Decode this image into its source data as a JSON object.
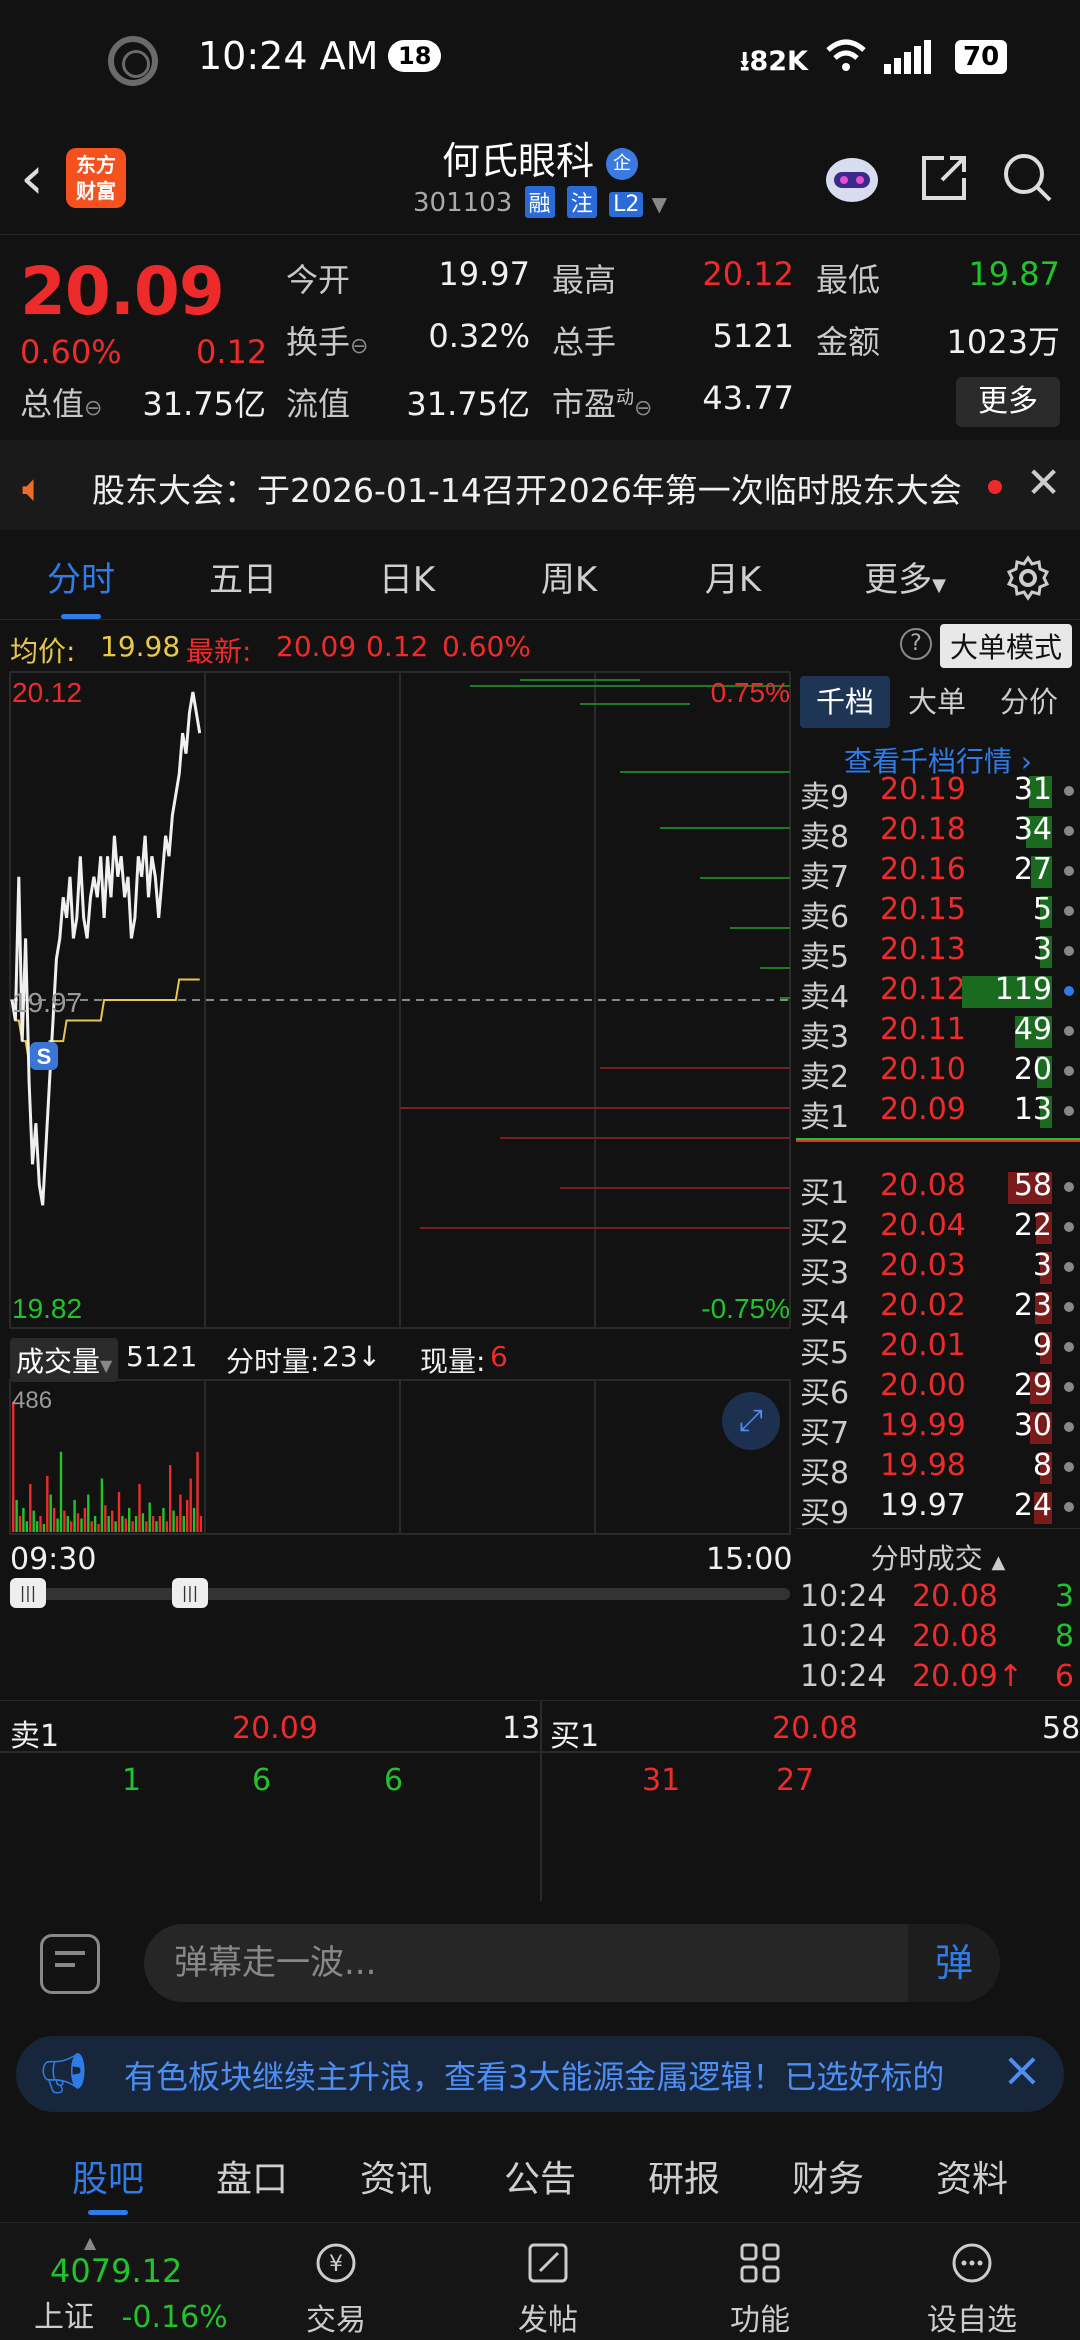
{
  "status": {
    "time": "10:24 AM",
    "badge": "18",
    "net": "82K",
    "battery": "70"
  },
  "header": {
    "logo_text_1": "东方",
    "logo_text_2": "财富",
    "name": "何氏眼科",
    "name_tag": "企",
    "code": "301103",
    "tags": [
      "融",
      "注",
      "L2"
    ]
  },
  "quote": {
    "price": "20.09",
    "change_pct": "0.60%",
    "change": "0.12",
    "rows": [
      [
        {
          "label": "今开",
          "value": "19.97",
          "color": "white"
        },
        {
          "label": "最高",
          "value": "20.12",
          "color": "red"
        },
        {
          "label": "最低",
          "value": "19.87",
          "color": "green"
        }
      ],
      [
        {
          "label": "换手",
          "value": "0.32%",
          "color": "white"
        },
        {
          "label": "总手",
          "value": "5121",
          "color": "white"
        },
        {
          "label": "金额",
          "value": "1023万",
          "color": "white"
        }
      ],
      [
        {
          "label": "总值",
          "value": "31.75亿",
          "color": "white"
        },
        {
          "label": "流值",
          "value": "31.75亿",
          "color": "white"
        },
        {
          "label": "市盈",
          "value": "43.77",
          "color": "white"
        }
      ]
    ],
    "pe_superscript": "动",
    "more_label": "更多"
  },
  "notice": {
    "text": "股东大会：于2026-01-14召开2026年第一次临时股东大会"
  },
  "chart_tabs": [
    "分时",
    "五日",
    "日K",
    "周K",
    "月K",
    "更多"
  ],
  "avg": {
    "avg_label": "均价:",
    "avg_value": "19.98",
    "latest_label": "最新:",
    "latest_value": "20.09",
    "change": "0.12",
    "pct": "0.60%",
    "mode_label": "大单模式",
    "help": "?"
  },
  "chart": {
    "top_price": "20.12",
    "top_pct": "0.75%",
    "mid_price": "19.97",
    "bottom_price": "19.82",
    "bottom_pct": "-0.75%",
    "s_marker": "S"
  },
  "volume": {
    "label": "成交量",
    "total": "5121",
    "minute_label": "分时量:",
    "minute_value": "23↓",
    "now_label": "现量:",
    "now_value": "6",
    "max": "486",
    "time_start": "09:30",
    "time_end": "15:00"
  },
  "orderbook": {
    "tabs": [
      "千档",
      "大单",
      "分价"
    ],
    "link": "查看千档行情 ›",
    "asks": [
      {
        "label": "卖9",
        "price": "20.19",
        "qty": "31",
        "w": 0.26
      },
      {
        "label": "卖8",
        "price": "20.18",
        "qty": "34",
        "w": 0.29
      },
      {
        "label": "卖7",
        "price": "20.16",
        "qty": "27",
        "w": 0.23
      },
      {
        "label": "卖6",
        "price": "20.15",
        "qty": "5",
        "w": 0.04
      },
      {
        "label": "卖5",
        "price": "20.13",
        "qty": "3",
        "w": 0.03
      },
      {
        "label": "卖4",
        "price": "20.12",
        "qty": "119",
        "w": 1.0
      },
      {
        "label": "卖3",
        "price": "20.11",
        "qty": "49",
        "w": 0.41
      },
      {
        "label": "卖2",
        "price": "20.10",
        "qty": "20",
        "w": 0.17
      },
      {
        "label": "卖1",
        "price": "20.09",
        "qty": "13",
        "w": 0.11
      }
    ],
    "bids": [
      {
        "label": "买1",
        "price": "20.08",
        "qty": "58",
        "w": 0.49
      },
      {
        "label": "买2",
        "price": "20.04",
        "qty": "22",
        "w": 0.18
      },
      {
        "label": "买3",
        "price": "20.03",
        "qty": "3",
        "w": 0.03
      },
      {
        "label": "买4",
        "price": "20.02",
        "qty": "23",
        "w": 0.19
      },
      {
        "label": "买5",
        "price": "20.01",
        "qty": "9",
        "w": 0.08
      },
      {
        "label": "买6",
        "price": "20.00",
        "qty": "29",
        "w": 0.24
      },
      {
        "label": "买7",
        "price": "19.99",
        "qty": "30",
        "w": 0.25
      },
      {
        "label": "买8",
        "price": "19.98",
        "qty": "8",
        "w": 0.07
      },
      {
        "label": "买9",
        "price": "19.97",
        "qty": "24",
        "w": 0.2
      }
    ],
    "trades_title": "分时成交",
    "trades": [
      {
        "time": "10:24",
        "price": "20.08",
        "qty": "3",
        "qcolor": "green"
      },
      {
        "time": "10:24",
        "price": "20.08",
        "qty": "8",
        "qcolor": "green"
      },
      {
        "time": "10:24",
        "price": "20.09↑",
        "qty": "6",
        "qcolor": "red"
      }
    ]
  },
  "levels": {
    "sell_label": "卖1",
    "sell_price": "20.09",
    "sell_qty": "13",
    "buy_label": "买1",
    "buy_price": "20.08",
    "buy_qty": "58",
    "sell_queue": [
      "1",
      "6",
      "6"
    ],
    "buy_queue": [
      "31",
      "27"
    ]
  },
  "comment": {
    "placeholder": "弹幕走一波...",
    "send": "弹"
  },
  "promo": {
    "text": "有色板块继续主升浪，查看3大能源金属逻辑！已选好标的"
  },
  "bottom_tabs": [
    "股吧",
    "盘口",
    "资讯",
    "公告",
    "研报",
    "财务",
    "资料"
  ],
  "bottom_nav": {
    "index_value": "4079.12",
    "index_name": "上证",
    "index_change": "-0.16%",
    "items": [
      "交易",
      "发帖",
      "功能",
      "设自选"
    ]
  },
  "chart_data": {
    "type": "line",
    "title": "",
    "ylim": [
      19.82,
      20.12
    ],
    "x": [
      0,
      1,
      2,
      3,
      4,
      5,
      6,
      7,
      8,
      9,
      10,
      11,
      12,
      13,
      14,
      15,
      16,
      17,
      18,
      19,
      20,
      21,
      22,
      23,
      24,
      25,
      26,
      27,
      28,
      29,
      30,
      31,
      32,
      33,
      34,
      35,
      36,
      37,
      38,
      39,
      40,
      41,
      42,
      43,
      44,
      45,
      46,
      47,
      48,
      49,
      50,
      51,
      52,
      53,
      54,
      55
    ],
    "series": [
      {
        "name": "",
        "color": "#f0f0f0",
        "values": [
          19.97,
          19.96,
          20.03,
          19.95,
          20.0,
          19.93,
          19.89,
          19.91,
          19.88,
          19.87,
          19.9,
          19.93,
          19.96,
          19.99,
          20.0,
          20.02,
          20.01,
          20.03,
          20.0,
          20.01,
          20.04,
          20.01,
          20.0,
          20.02,
          20.03,
          20.02,
          20.04,
          20.01,
          20.04,
          20.02,
          20.05,
          20.03,
          20.04,
          20.02,
          20.03,
          20.0,
          20.01,
          20.04,
          20.03,
          20.05,
          20.02,
          20.04,
          20.03,
          20.01,
          20.03,
          20.05,
          20.04,
          20.06,
          20.07,
          20.08,
          20.1,
          20.09,
          20.11,
          20.12,
          20.11,
          20.1
        ]
      },
      {
        "name": "",
        "color": "#e8c847",
        "values": [
          19.97,
          19.96,
          19.96,
          19.95,
          19.95,
          19.94,
          19.94,
          19.94,
          19.94,
          19.94,
          19.94,
          19.95,
          19.95,
          19.95,
          19.95,
          19.95,
          19.96,
          19.96,
          19.96,
          19.96,
          19.96,
          19.96,
          19.96,
          19.96,
          19.96,
          19.96,
          19.96,
          19.97,
          19.97,
          19.97,
          19.97,
          19.97,
          19.97,
          19.97,
          19.97,
          19.97,
          19.97,
          19.97,
          19.97,
          19.97,
          19.97,
          19.97,
          19.97,
          19.97,
          19.97,
          19.97,
          19.97,
          19.97,
          19.97,
          19.98,
          19.98,
          19.98,
          19.98,
          19.98,
          19.98,
          19.98
        ]
      }
    ],
    "volume": [
      486,
      120,
      60,
      90,
      40,
      180,
      80,
      40,
      60,
      30,
      210,
      140,
      90,
      50,
      300,
      80,
      60,
      40,
      120,
      70,
      50,
      90,
      140,
      40,
      60,
      30,
      200,
      100,
      60,
      80,
      40,
      150,
      60,
      50,
      90,
      40,
      60,
      180,
      70,
      40,
      110,
      60,
      40,
      60,
      90,
      40,
      250,
      80,
      60,
      140,
      60,
      120,
      200,
      90,
      300,
      60
    ],
    "volume_colors": [
      "red",
      "green",
      "red",
      "green",
      "green",
      "red",
      "green",
      "green",
      "red",
      "green",
      "red",
      "green",
      "red",
      "green",
      "green",
      "red",
      "green",
      "red",
      "green",
      "red",
      "green",
      "red",
      "green",
      "red",
      "green",
      "red",
      "green",
      "red",
      "green",
      "red",
      "green",
      "red",
      "green",
      "red",
      "green",
      "red",
      "green",
      "red",
      "green",
      "red",
      "green",
      "red",
      "green",
      "red",
      "green",
      "red",
      "red",
      "green",
      "red",
      "red",
      "green",
      "red",
      "red",
      "green",
      "red",
      "red"
    ]
  }
}
